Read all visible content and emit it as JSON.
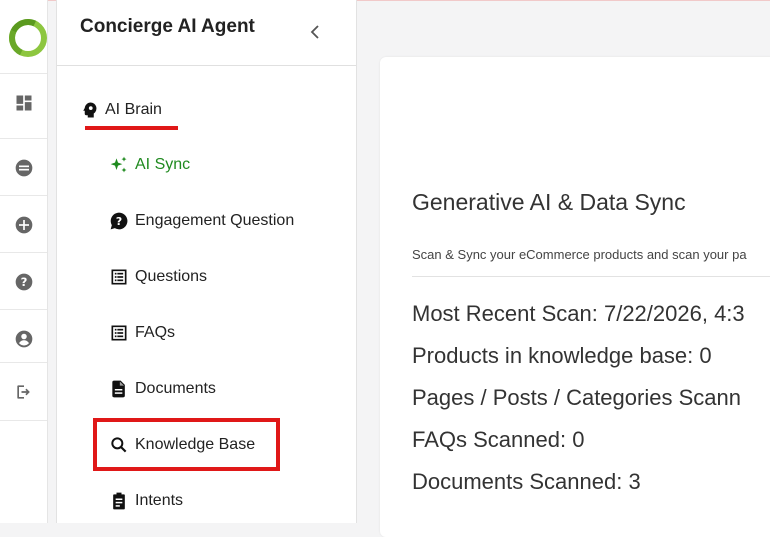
{
  "app": {
    "title": "Concierge AI Agent",
    "accent_color": "#1f8a1f",
    "highlight_color": "#e01818",
    "logo": "ring-logo-icon"
  },
  "rail": {
    "items": [
      {
        "icon": "dashboard-icon"
      },
      {
        "icon": "chat-icon"
      },
      {
        "icon": "add-circle-icon"
      },
      {
        "icon": "help-icon"
      },
      {
        "icon": "account-icon"
      },
      {
        "icon": "logout-icon"
      }
    ]
  },
  "sidebar": {
    "section_label": "AI Brain",
    "items": [
      {
        "label": "AI Sync",
        "icon": "sparkle-icon",
        "active": true
      },
      {
        "label": "Engagement Question",
        "icon": "question-bubble-icon"
      },
      {
        "label": "Questions",
        "icon": "list-icon"
      },
      {
        "label": "FAQs",
        "icon": "list-icon"
      },
      {
        "label": "Documents",
        "icon": "document-icon"
      },
      {
        "label": "Knowledge Base",
        "icon": "search-icon"
      },
      {
        "label": "Intents",
        "icon": "clipboard-icon"
      }
    ]
  },
  "main": {
    "title": "Generative AI & Data Sync",
    "description": "Scan & Sync your eCommerce products and scan your pa",
    "stats": [
      "Most Recent Scan: 7/22/2026, 4:3",
      "Products in knowledge base: 0",
      "Pages / Posts / Categories Scann",
      "FAQs Scanned: 0",
      "Documents Scanned: 3"
    ]
  }
}
